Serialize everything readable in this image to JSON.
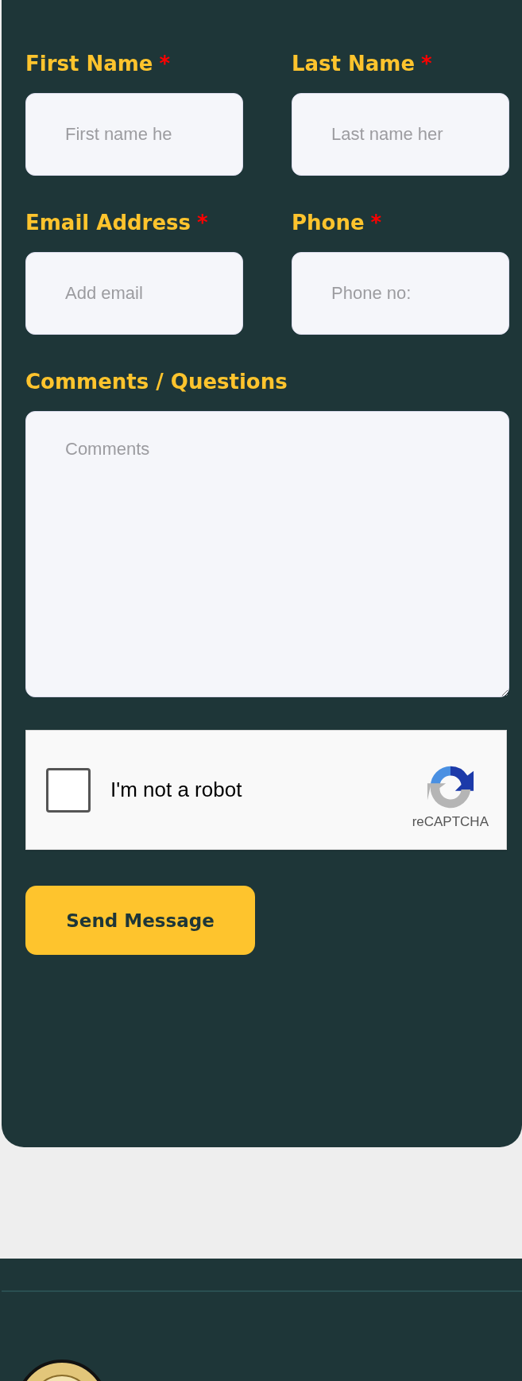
{
  "form": {
    "fields": [
      {
        "label": "First Name",
        "required_mark": "*",
        "placeholder": "First name he",
        "kind": "input"
      },
      {
        "label": "Last Name",
        "required_mark": "*",
        "placeholder": "Last name her",
        "kind": "input"
      },
      {
        "label": "Email Address",
        "required_mark": "*",
        "placeholder": "Add email",
        "kind": "input"
      },
      {
        "label": "Phone",
        "required_mark": "*",
        "placeholder": "Phone no:",
        "kind": "input"
      },
      {
        "label": "Comments / Questions",
        "placeholder": "Comments",
        "kind": "textarea"
      }
    ],
    "captcha": {
      "label": "I'm not a robot",
      "checked": false,
      "brand": "reCAPTCHA"
    },
    "submit": {
      "label": "Send Message"
    }
  }
}
